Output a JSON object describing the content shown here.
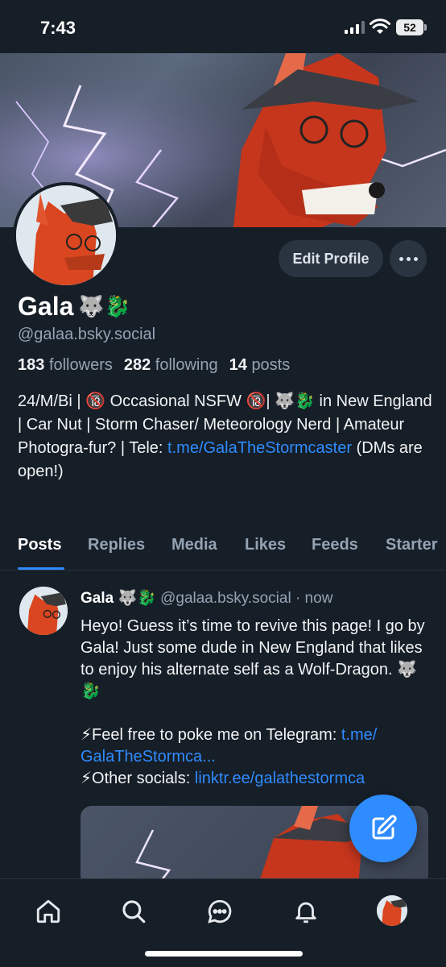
{
  "status": {
    "time": "7:43",
    "battery": "52"
  },
  "profile": {
    "name": "Gala",
    "name_emoji": "🐺🐉",
    "handle": "@galaa.bsky.social",
    "edit_label": "Edit Profile",
    "stats": {
      "followers_count": "183",
      "followers_label": "followers",
      "following_count": "282",
      "following_label": "following",
      "posts_count": "14",
      "posts_label": "posts"
    },
    "bio_text": "24/M/Bi | 🔞 Occasional NSFW 🔞| 🐺🐉 in New England | Car Nut | Storm Chaser/ Meteorology Nerd | Amateur Photogra-fur? | Tele: ",
    "bio_link": "t.me/GalaTheStormcaster",
    "bio_tail": " (DMs are open!)"
  },
  "tabs": [
    "Posts",
    "Replies",
    "Media",
    "Likes",
    "Feeds",
    "Starter"
  ],
  "post": {
    "author": "Gala",
    "author_emoji": "🐺🐉",
    "handle": "@galaa.bsky.social",
    "time": "· now",
    "line1": "Heyo! Guess it’s time to revive this page! I go by Gala! Just some dude in New England that likes to enjoy his alternate self as a Wolf-Dragon. 🐺🐉",
    "line2_prefix": "⚡Feel free to poke me on Telegram: ",
    "line2_link": "t.me/ GalaTheStormca...",
    "line3_prefix": "⚡Other socials: ",
    "line3_link": "linktr.ee/galathestormca"
  },
  "icons": [
    "home-icon",
    "search-icon",
    "chat-icon",
    "bell-icon",
    "compose-icon"
  ],
  "colors": {
    "background": "#161e27",
    "accent": "#2f8cff",
    "muted": "#94a3b3"
  }
}
